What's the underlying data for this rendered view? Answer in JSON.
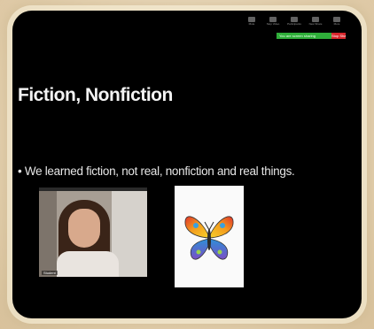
{
  "toolbar": {
    "items": [
      {
        "icon": "mute-icon",
        "label": "Mute"
      },
      {
        "icon": "video-icon",
        "label": "Stop Video"
      },
      {
        "icon": "participants-icon",
        "label": "Participants"
      },
      {
        "icon": "share-icon",
        "label": "New Share"
      },
      {
        "icon": "more-icon",
        "label": "More"
      }
    ]
  },
  "share_bar": {
    "status": "You are screen sharing",
    "stop_label": "Stop Share",
    "colors": {
      "status": "#2fae3a",
      "stop": "#d8262c"
    }
  },
  "slide": {
    "title": "Fiction, Nonfiction",
    "bullet": "• We learned fiction, not real, nonfiction and real things."
  },
  "video_tile": {
    "participant_name": "Student"
  },
  "image_card": {
    "icon": "butterfly-icon"
  }
}
